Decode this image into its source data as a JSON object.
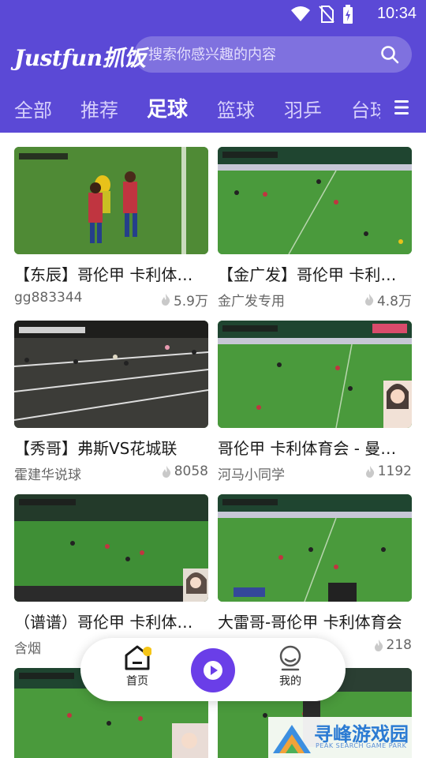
{
  "status_bar": {
    "time": "10:34"
  },
  "header": {
    "logo": "Justfun抓饭",
    "search_placeholder": "搜索你感兴趣的内容"
  },
  "tabs": [
    {
      "label": "全部",
      "active": false
    },
    {
      "label": "推荐",
      "active": false
    },
    {
      "label": "足球",
      "active": true
    },
    {
      "label": "篮球",
      "active": false
    },
    {
      "label": "羽乒",
      "active": false
    },
    {
      "label": "台球",
      "active": false
    }
  ],
  "videos": [
    {
      "title": "【东辰】哥伦甲 卡利体育会 - 曼",
      "author": "gg883344",
      "views": "5.9万"
    },
    {
      "title": "【金广发】哥伦甲  卡利体育会",
      "author": "金广发专用",
      "views": "4.8万"
    },
    {
      "title": "【秀哥】弗斯VS花城联",
      "author": "霍建华说球",
      "views": "8058"
    },
    {
      "title": " 哥伦甲 卡利体育会 - 曼萨雷斯",
      "author": "河马小同学",
      "views": "1192"
    },
    {
      "title": "（谱谱）哥伦甲 卡利体育会",
      "author": "含烟",
      "views": ""
    },
    {
      "title": "大雷哥-哥伦甲  卡利体育会",
      "author": "",
      "views": "218"
    },
    {
      "title": "",
      "author": "",
      "views": ""
    },
    {
      "title": "",
      "author": "",
      "views": ""
    }
  ],
  "bottom_nav": {
    "home_label": "首页",
    "mine_label": "我的"
  },
  "watermark": {
    "text": "寻峰游戏园",
    "sub": "PEAK SEARCH GAME PARK"
  },
  "colors": {
    "header_bg": "#5b49d6",
    "play_button": "#6a3ee8",
    "home_accent": "#f5c518"
  }
}
